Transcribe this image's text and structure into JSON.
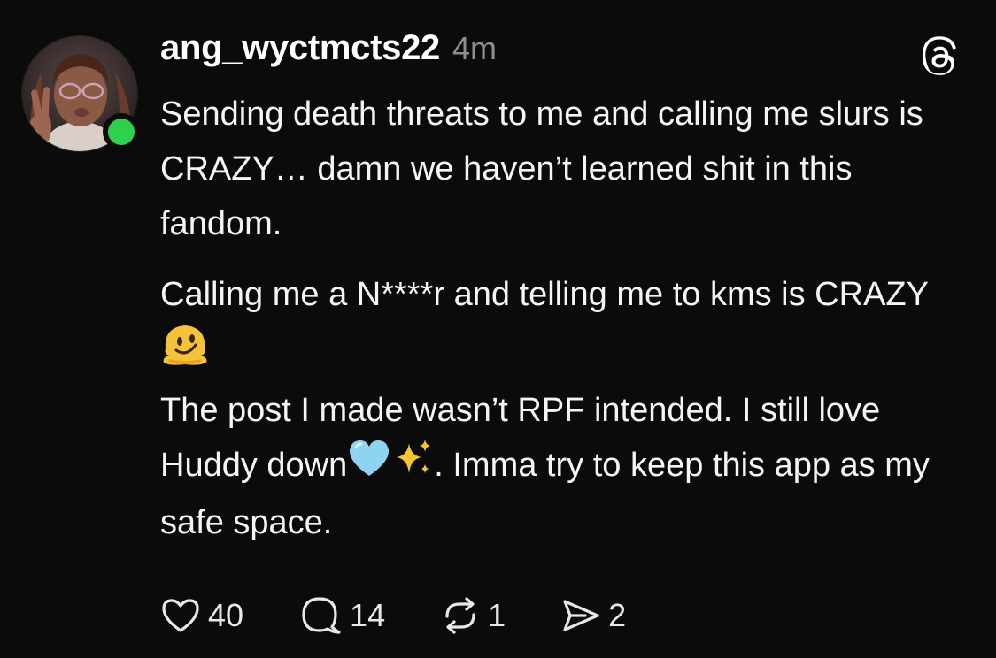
{
  "post": {
    "username": "ang_wyctmcts22",
    "time": "4m",
    "online": true,
    "paragraph1": "Sending death threats to me and calling me slurs is CRAZY… damn we haven’t learned shit in this fandom.",
    "paragraph2_text": "Calling me a N****r and telling me to kms is CRAZY",
    "paragraph2_emoji": "melting-face-emoji",
    "paragraph3_before": "The post I made wasn’t RPF intended. I still love Huddy down",
    "paragraph3_emojis": [
      "light-blue-heart-emoji",
      "sparkles-emoji"
    ],
    "paragraph3_after": ". Imma try to keep this app as my safe space."
  },
  "actions": {
    "likes": "40",
    "comments": "14",
    "reposts": "1",
    "shares": "2"
  },
  "icons": {
    "brand": "threads-logo-icon",
    "like": "heart-icon",
    "comment": "comment-bubble-icon",
    "repost": "repost-icon",
    "share": "send-icon"
  },
  "colors": {
    "background": "#0b0b0b",
    "text": "#f5f5f5",
    "muted": "#8e8e8e",
    "online": "#2fd04d"
  }
}
